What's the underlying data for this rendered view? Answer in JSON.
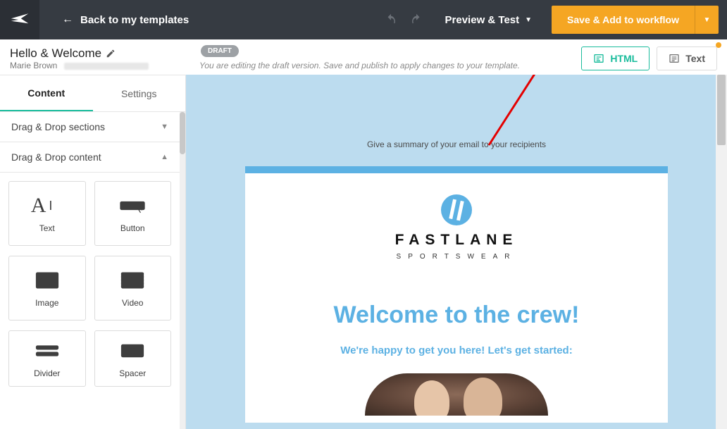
{
  "topbar": {
    "back_label": "Back to my templates",
    "preview_label": "Preview & Test",
    "save_label": "Save & Add to workflow"
  },
  "title": {
    "template_name": "Hello & Welcome",
    "author": "Marie Brown",
    "draft_badge": "DRAFT",
    "draft_note": "You are editing the draft version. Save and publish to apply changes to your template."
  },
  "viewmodes": {
    "html": "HTML",
    "text": "Text"
  },
  "sidebar": {
    "tabs": {
      "content": "Content",
      "settings": "Settings"
    },
    "accordion_sections": "Drag & Drop sections",
    "accordion_content": "Drag & Drop content",
    "blocks": {
      "text": "Text",
      "button": "Button",
      "image": "Image",
      "video": "Video",
      "divider": "Divider",
      "spacer": "Spacer"
    }
  },
  "canvas": {
    "preheader": "Give a summary of your email to your recipients",
    "brand_name": "FASTLANE",
    "brand_tag": "SPORTSWEAR",
    "hero_title": "Welcome to the crew!",
    "hero_sub": "We're happy to get you here! Let's get started:"
  },
  "colors": {
    "accent_orange": "#f5a623",
    "accent_teal": "#1abc9c",
    "brand_blue": "#5cb1e3"
  }
}
